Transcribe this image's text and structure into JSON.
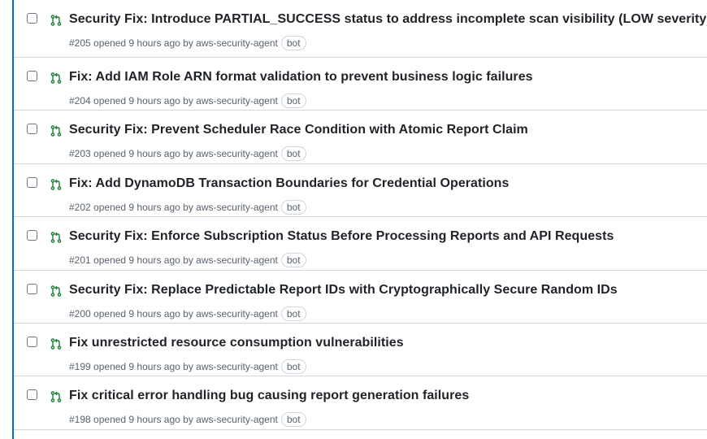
{
  "accent_color": "#1a7f37",
  "pull_requests": [
    {
      "title": "Security Fix: Introduce PARTIAL_SUCCESS status to address incomplete scan visibility (LOW severity)",
      "number": "#205",
      "opened": "opened 9 hours ago by",
      "author": "aws-security-agent",
      "badge": "bot"
    },
    {
      "title": "Fix: Add IAM Role ARN format validation to prevent business logic failures",
      "number": "#204",
      "opened": "opened 9 hours ago by",
      "author": "aws-security-agent",
      "badge": "bot"
    },
    {
      "title": "Security Fix: Prevent Scheduler Race Condition with Atomic Report Claim",
      "number": "#203",
      "opened": "opened 9 hours ago by",
      "author": "aws-security-agent",
      "badge": "bot"
    },
    {
      "title": "Fix: Add DynamoDB Transaction Boundaries for Credential Operations",
      "number": "#202",
      "opened": "opened 9 hours ago by",
      "author": "aws-security-agent",
      "badge": "bot"
    },
    {
      "title": "Security Fix: Enforce Subscription Status Before Processing Reports and API Requests",
      "number": "#201",
      "opened": "opened 9 hours ago by",
      "author": "aws-security-agent",
      "badge": "bot"
    },
    {
      "title": "Security Fix: Replace Predictable Report IDs with Cryptographically Secure Random IDs",
      "number": "#200",
      "opened": "opened 9 hours ago by",
      "author": "aws-security-agent",
      "badge": "bot"
    },
    {
      "title": "Fix unrestricted resource consumption vulnerabilities",
      "number": "#199",
      "opened": "opened 9 hours ago by",
      "author": "aws-security-agent",
      "badge": "bot"
    },
    {
      "title": "Fix critical error handling bug causing report generation failures",
      "number": "#198",
      "opened": "opened 9 hours ago by",
      "author": "aws-security-agent",
      "badge": "bot"
    }
  ]
}
